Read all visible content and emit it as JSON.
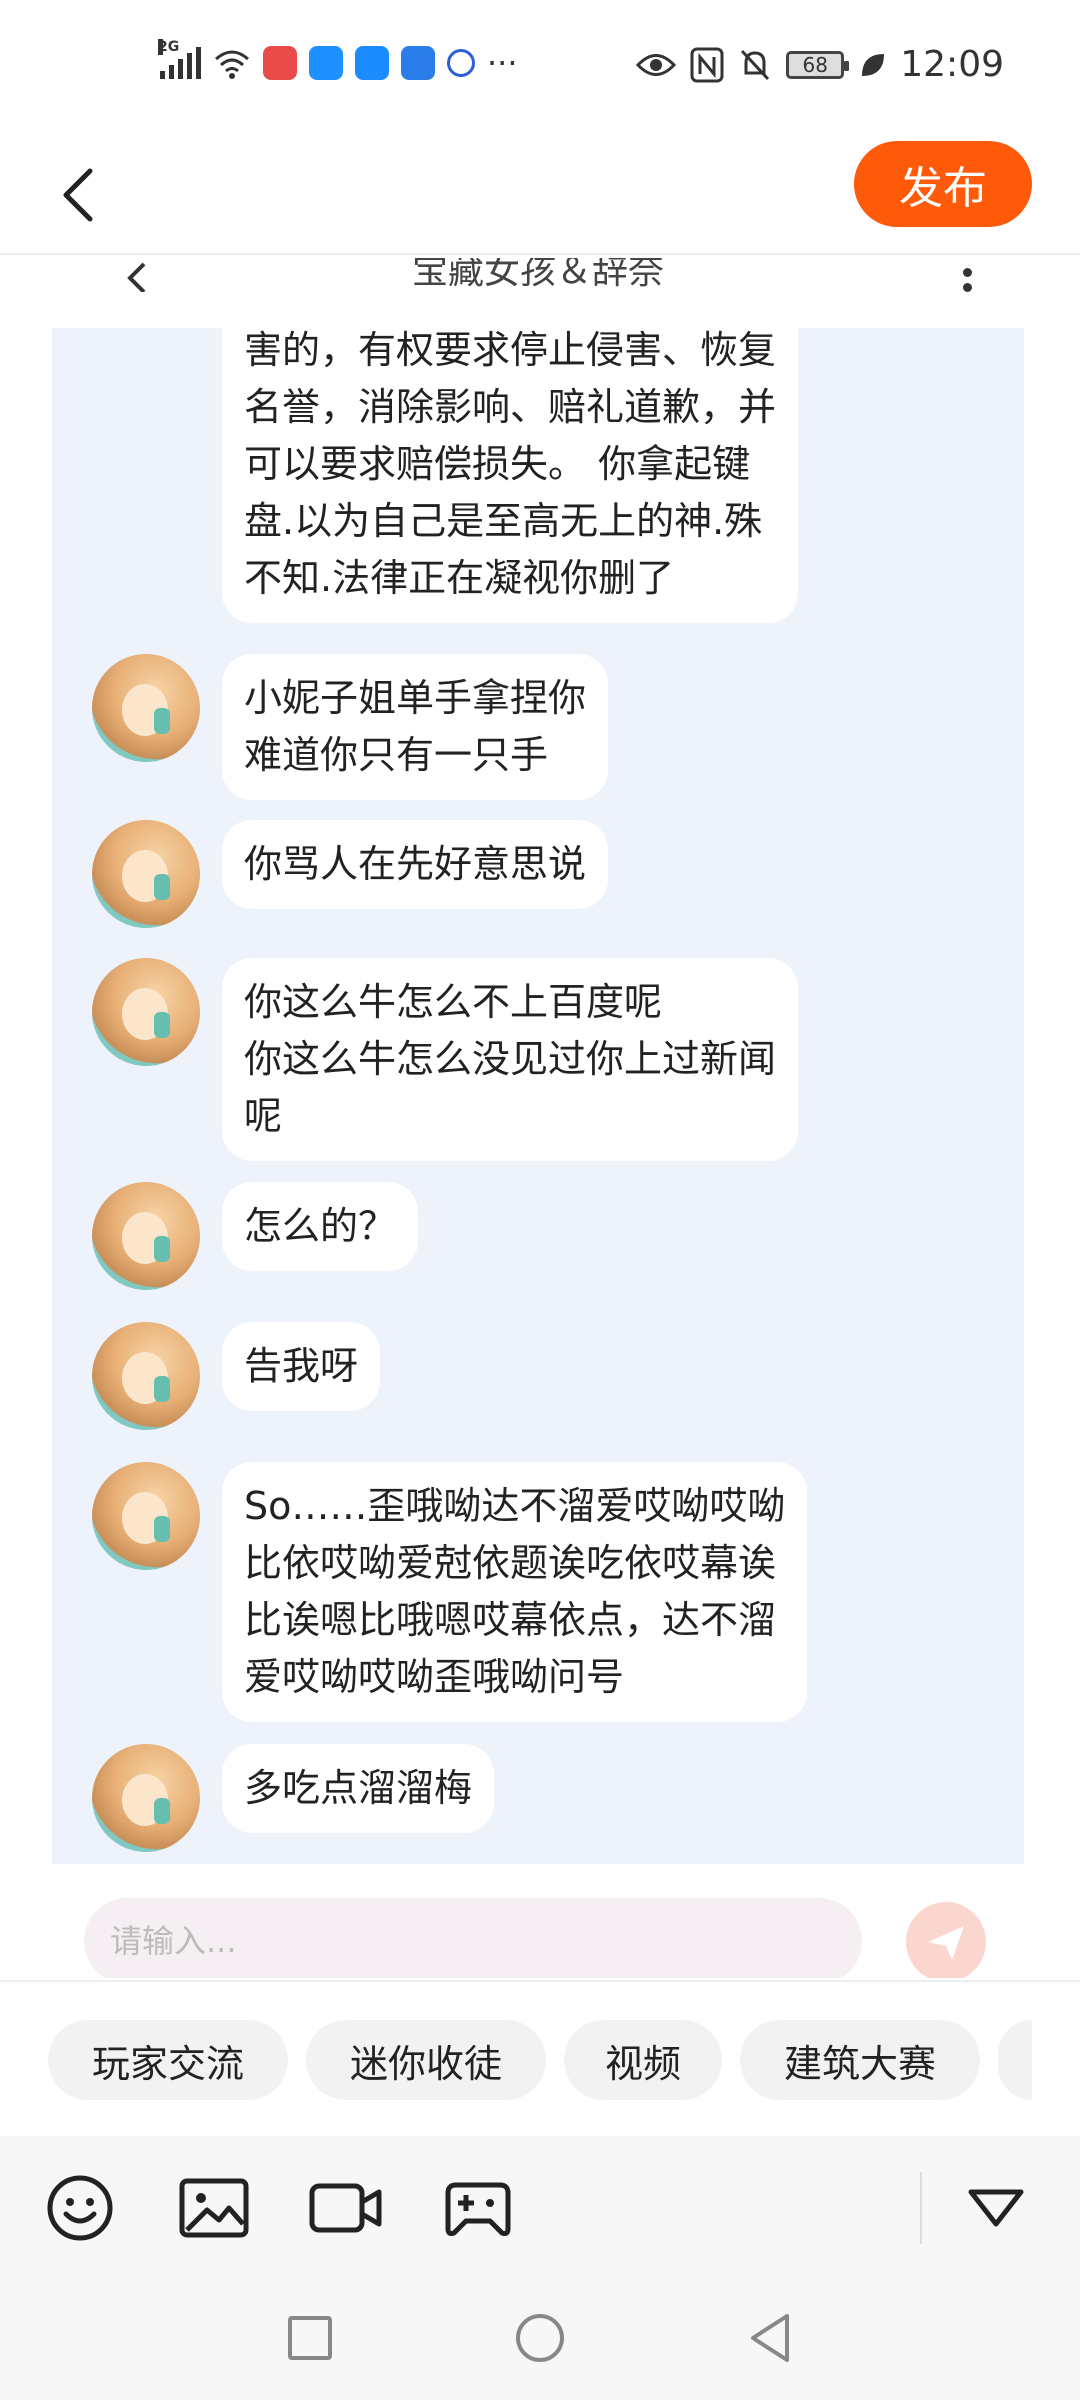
{
  "status_bar": {
    "network": "2G",
    "time": "12:09",
    "battery": "68",
    "more": "···",
    "app_icon_colors": [
      "#e94b4b",
      "#1e90ff",
      "#1a8cff",
      "#2b7de9",
      "#2b5fd9"
    ]
  },
  "header": {
    "publish_label": "发布"
  },
  "chat": {
    "title": "宝藏女孩＆辞奈",
    "messages": [
      "害的，有权要求停止侵害、恢复\n名誉，消除影响、赔礼道歉，并\n可以要求赔偿损失。  你拿起键\n盘.以为自己是至高无上的神.殊\n不知.法律正在凝视你删了",
      "小妮子姐单手拿捏你\n难道你只有一只手",
      "你骂人在先好意思说",
      "你这么牛怎么不上百度呢\n你这么牛怎么没见过你上过新闻\n呢",
      "怎么的？",
      "告我呀",
      "So……歪哦呦达不溜爱哎呦哎呦\n比依哎呦爱尅依题诶吃依哎幕诶\n比诶嗯比哦嗯哎幕依点，达不溜\n爱哎呦哎呦歪哦呦问号",
      "多吃点溜溜梅"
    ],
    "input_placeholder": "请输入..."
  },
  "chips": [
    "玩家交流",
    "迷你收徒",
    "视频",
    "建筑大赛",
    ""
  ],
  "toolbar": {
    "icons": [
      "emoji-icon",
      "image-icon",
      "video-icon",
      "gamepad-icon",
      "collapse-icon"
    ]
  },
  "navbar": {
    "icons": [
      "recent-apps-icon",
      "home-icon",
      "back-icon"
    ]
  },
  "colors": {
    "accent": "#ff5a0a",
    "chat_background": "#eef3fb",
    "bubble": "#ffffff"
  }
}
